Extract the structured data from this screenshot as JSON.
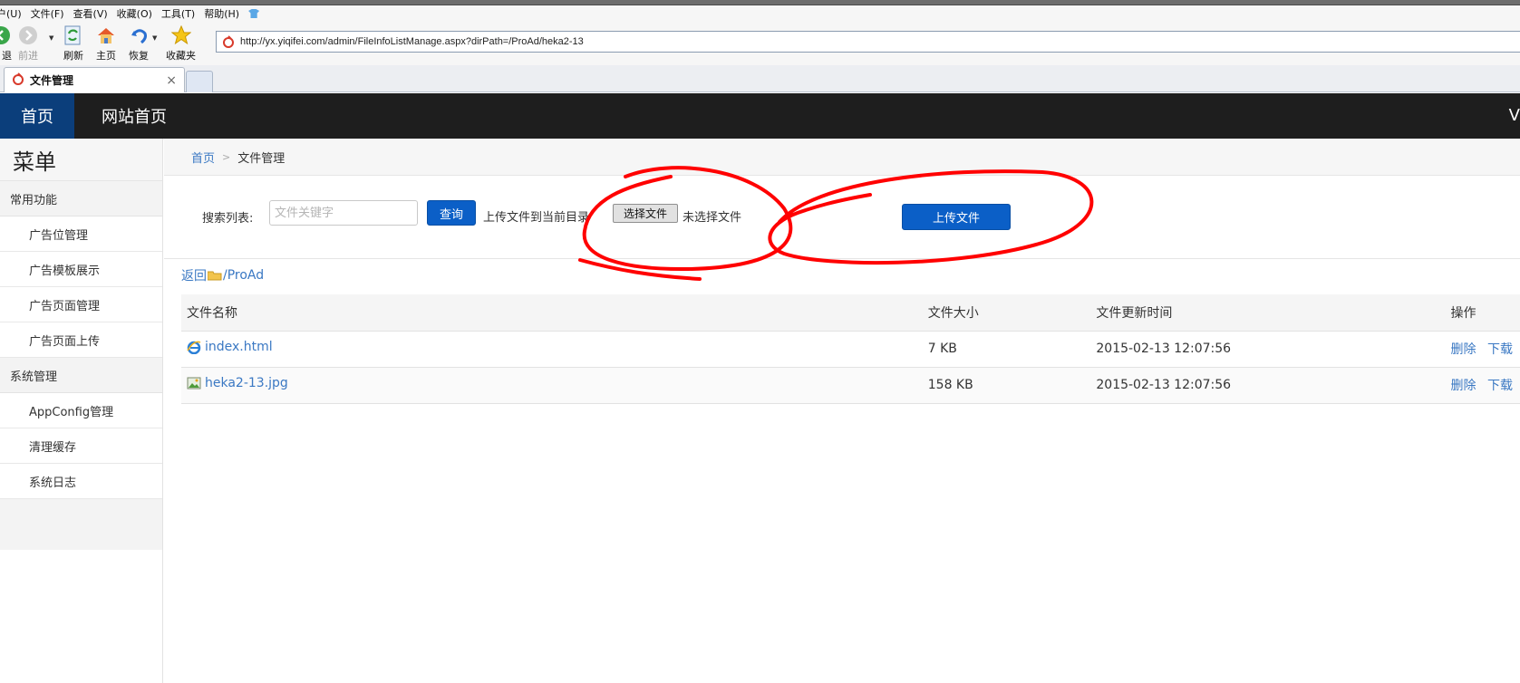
{
  "browser": {
    "menu": [
      "户(U)",
      "文件(F)",
      "查看(V)",
      "收藏(O)",
      "工具(T)",
      "帮助(H)"
    ],
    "toolbar": {
      "back": "退",
      "forward": "前进",
      "refresh": "刷新",
      "home": "主页",
      "restore": "恢复",
      "favorites": "收藏夹"
    },
    "address": "http://yx.yiqifei.com/admin/FileInfoListManage.aspx?dirPath=/ProAd/heka2-13",
    "tab": {
      "title": "文件管理",
      "close": "×"
    }
  },
  "header": {
    "home": "首页",
    "site_home": "网站首页",
    "edge_glyph": "V"
  },
  "sidebar": {
    "title": "菜单",
    "groups": [
      {
        "label": "常用功能",
        "items": [
          "广告位管理",
          "广告模板展示",
          "广告页面管理",
          "广告页面上传"
        ]
      },
      {
        "label": "系统管理",
        "items": [
          "AppConfig管理",
          "清理缓存",
          "系统日志"
        ]
      }
    ]
  },
  "breadcrumb": {
    "home": "首页",
    "separator": ">",
    "current": "文件管理"
  },
  "search": {
    "label": "搜索列表:",
    "placeholder": "文件关键字",
    "query_button": "查询",
    "upload_label": "上传文件到当前目录",
    "choose_file_button": "选择文件",
    "no_file_text": "未选择文件",
    "upload_button": "上传文件"
  },
  "path": {
    "back": "返回",
    "current": "/ProAd"
  },
  "table": {
    "headers": [
      "文件名称",
      "文件大小",
      "文件更新时间",
      "操作"
    ],
    "rows": [
      {
        "name": "index.html",
        "icon": "ie-html-icon",
        "size": "7 KB",
        "time": "2015-02-13 12:07:56",
        "ops": [
          "删除",
          "下载"
        ]
      },
      {
        "name": "heka2-13.jpg",
        "icon": "image-file-icon",
        "size": "158 KB",
        "time": "2015-02-13 12:07:56",
        "ops": [
          "删除",
          "下载"
        ]
      }
    ]
  },
  "colors": {
    "header_bg": "#1e1e1e",
    "header_active": "#0b3e7b",
    "primary_button": "#0b5fc7",
    "link": "#3a78c3",
    "annotation": "#ff0000"
  }
}
